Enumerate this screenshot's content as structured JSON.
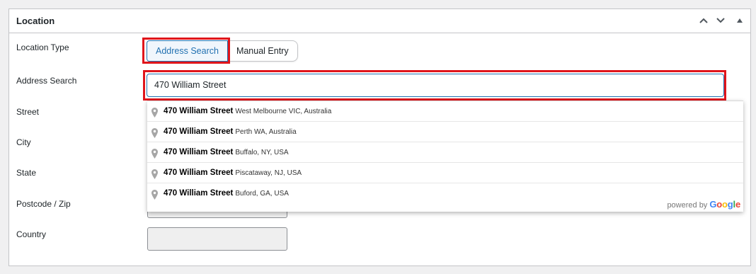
{
  "panel": {
    "title": "Location",
    "controls": {
      "move_up_icon": "chevron-up-icon",
      "move_down_icon": "chevron-down-icon",
      "toggle_icon": "triangle-up-icon"
    }
  },
  "fields": {
    "location_type_label": "Location Type",
    "address_search_label": "Address Search",
    "street_label": "Street",
    "city_label": "City",
    "state_label": "State",
    "postcode_label": "Postcode / Zip",
    "country_label": "Country"
  },
  "location_type": {
    "options": [
      "Address Search",
      "Manual Entry"
    ],
    "selected": "Address Search"
  },
  "address_search": {
    "value": "470 William Street"
  },
  "suggestions": [
    {
      "main": "470 William Street",
      "secondary": "West Melbourne VIC, Australia"
    },
    {
      "main": "470 William Street",
      "secondary": "Perth WA, Australia"
    },
    {
      "main": "470 William Street",
      "secondary": "Buffalo, NY, USA"
    },
    {
      "main": "470 William Street",
      "secondary": "Piscataway, NJ, USA"
    },
    {
      "main": "470 William Street",
      "secondary": "Buford, GA, USA"
    }
  ],
  "attribution": {
    "text": "powered by",
    "letters": [
      "G",
      "o",
      "o",
      "g",
      "l",
      "e"
    ]
  },
  "colors": {
    "accent": "#2271b1",
    "highlight": "#e0151b",
    "google_blue": "#4285f4",
    "google_red": "#ea4335",
    "google_yellow": "#fbbc05",
    "google_green": "#34a853"
  }
}
